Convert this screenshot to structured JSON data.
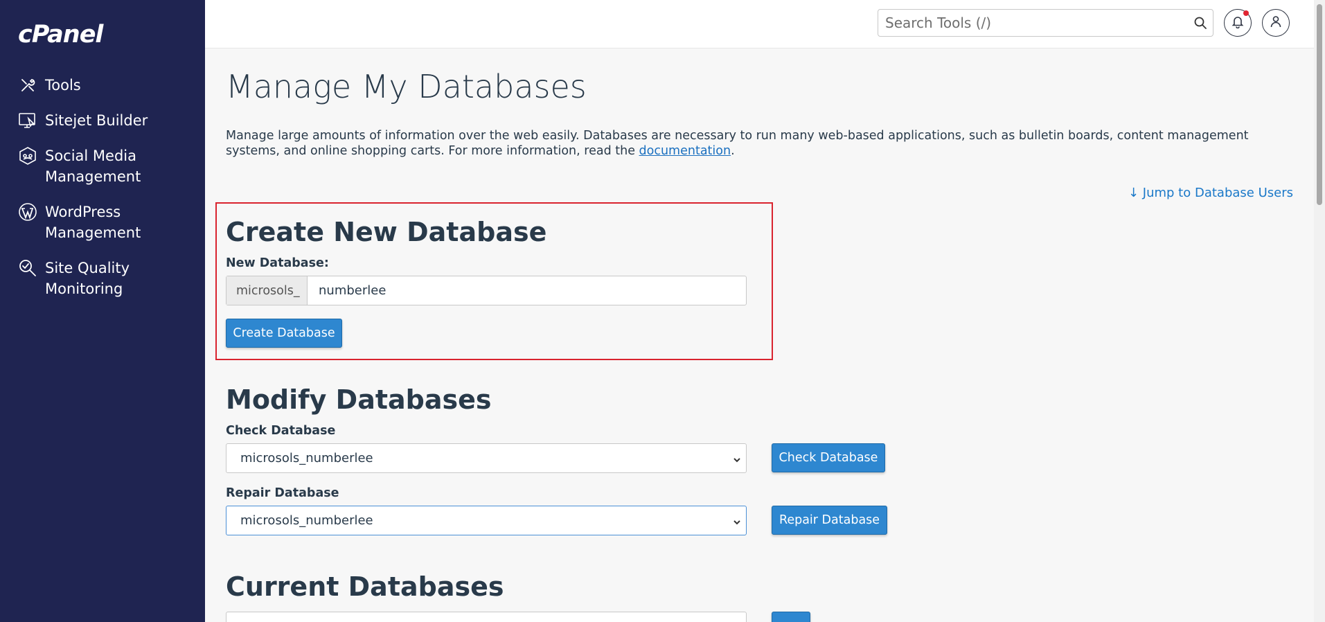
{
  "brand": {
    "logo_text": "cPanel"
  },
  "sidebar": {
    "items": [
      {
        "label": "Tools",
        "icon": "tools-icon"
      },
      {
        "label": "Sitejet Builder",
        "icon": "sitejet-icon"
      },
      {
        "label": "Social Media Management",
        "label_line1": "Social Media",
        "label_line2": "Management",
        "icon": "social-media-icon"
      },
      {
        "label": "WordPress Management",
        "label_line1": "WordPress",
        "label_line2": "Management",
        "icon": "wordpress-icon"
      },
      {
        "label": "Site Quality Monitoring",
        "label_line1": "Site Quality",
        "label_line2": "Monitoring",
        "icon": "site-quality-icon"
      }
    ]
  },
  "header": {
    "search_placeholder": "Search Tools (/)",
    "notifications_icon": "bell-icon",
    "user_icon": "user-icon"
  },
  "page": {
    "title": "Manage My Databases",
    "description_pre": "Manage large amounts of information over the web easily. Databases are necessary to run many web-based applications, such as bulletin boards, content management systems, and online shopping carts. For more information, read the ",
    "description_link": "documentation",
    "description_post": ".",
    "jump_link": "Jump to Database Users"
  },
  "create": {
    "heading": "Create New Database",
    "label": "New Database:",
    "prefix": "microsols_",
    "value": "numberlee",
    "button": "Create Database"
  },
  "modify": {
    "heading": "Modify Databases",
    "check_label": "Check Database",
    "check_value": "microsols_numberlee",
    "check_button": "Check Database",
    "repair_label": "Repair Database",
    "repair_value": "microsols_numberlee",
    "repair_button": "Repair Database"
  },
  "current": {
    "heading": "Current Databases"
  },
  "colors": {
    "sidebar_bg": "#1f2451",
    "button_blue": "#2e87d0",
    "highlight_red": "#d9232e",
    "link_blue": "#1a78c8"
  }
}
